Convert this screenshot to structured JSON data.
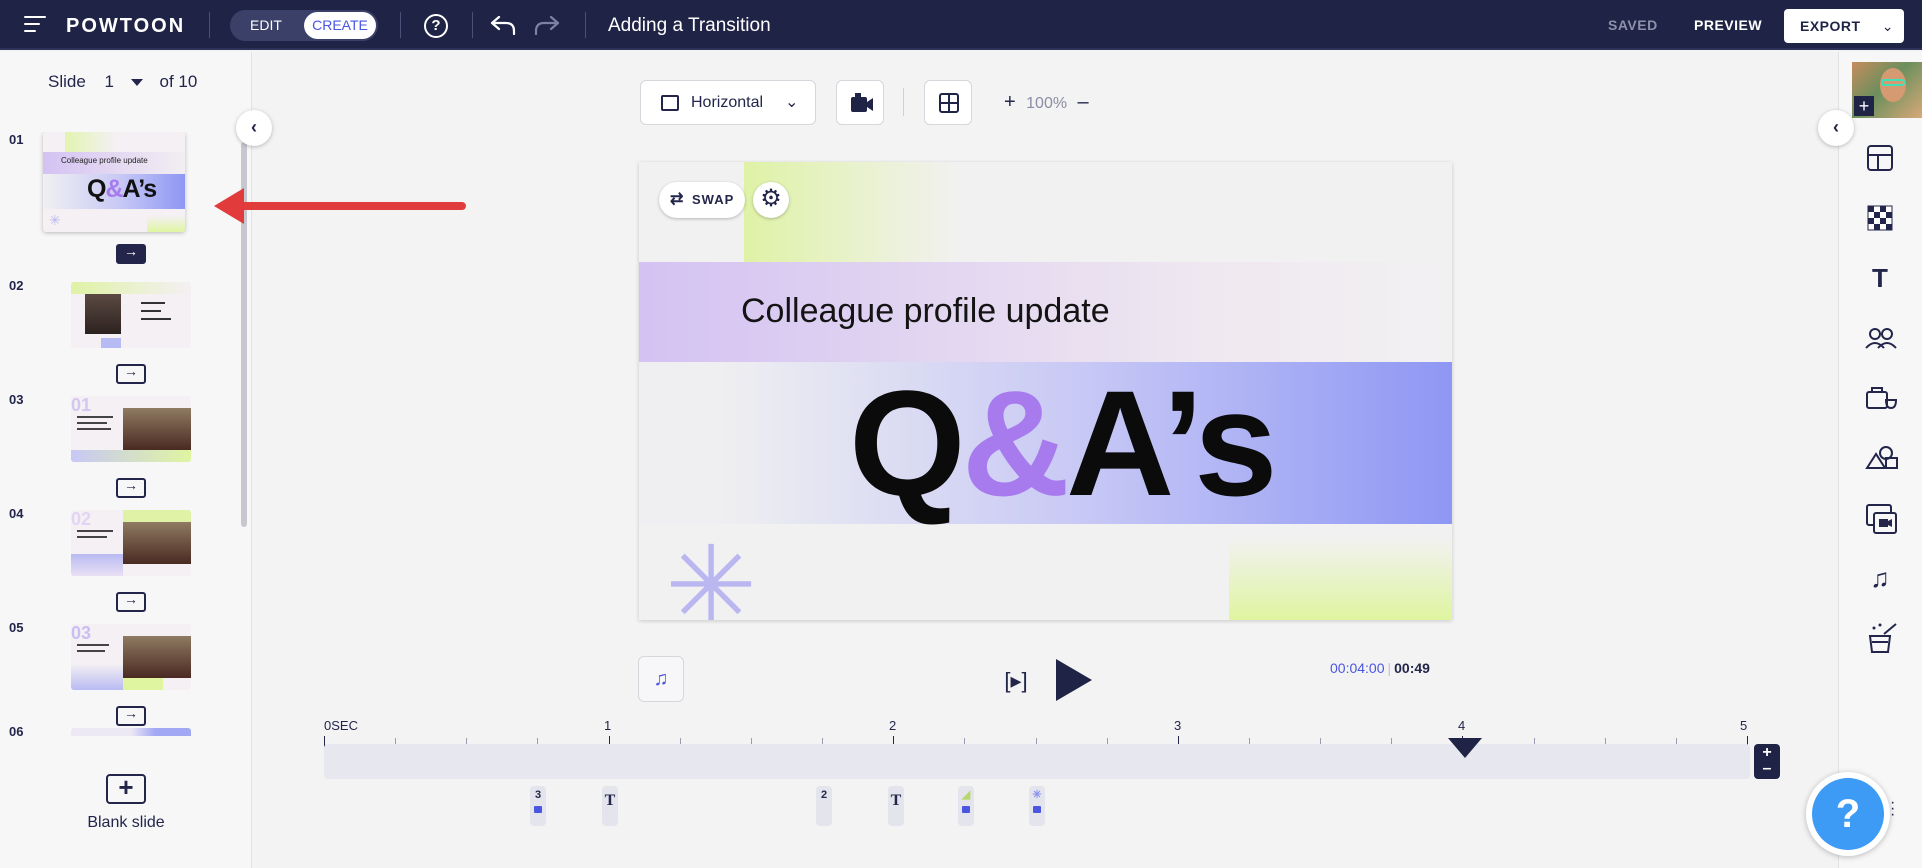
{
  "app": {
    "logo": "POWTOON",
    "mode_edit": "EDIT",
    "mode_create": "CREATE",
    "help": "?",
    "doc_title": "Adding a Transition",
    "saved": "SAVED",
    "preview": "PREVIEW",
    "export": "EXPORT"
  },
  "left": {
    "slide_label": "Slide",
    "slide_current": "1",
    "slide_of": "of 10",
    "blank_slide": "Blank slide",
    "slides": [
      {
        "num": "01"
      },
      {
        "num": "02"
      },
      {
        "num": "03"
      },
      {
        "num": "04"
      },
      {
        "num": "05"
      },
      {
        "num": "06"
      }
    ],
    "thumb1_sub": "Colleague profile update",
    "thumb1_title_a": "Q",
    "thumb1_title_amp": "&",
    "thumb1_title_b": "A’s",
    "thumb3_num": "01",
    "thumb4_num": "02",
    "thumb5_num": "03"
  },
  "toolbar": {
    "orientation": "Horizontal",
    "zoom_plus": "+",
    "zoom": "100%",
    "zoom_minus": "–"
  },
  "stage": {
    "swap": "SWAP",
    "subtitle": "Colleague profile update",
    "title_a": "Q",
    "title_amp": "&",
    "title_b": "A’s"
  },
  "playback": {
    "current": "00:04:00",
    "sep": "|",
    "duration": "00:49"
  },
  "timeline": {
    "ticks": [
      "0SEC",
      "1",
      "2",
      "3",
      "4",
      "5"
    ],
    "marker_labels": [
      "3",
      "T",
      "2",
      "T"
    ]
  },
  "colors": {
    "topbar": "#1f2447",
    "accent": "#4a55e0",
    "annotation_arrow": "#e23b3b",
    "help_fab": "#3d9af5"
  }
}
